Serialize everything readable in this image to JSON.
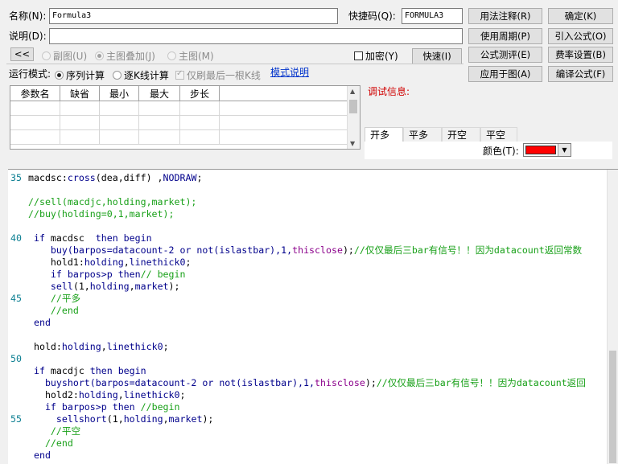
{
  "form": {
    "name_label": "名称(N):",
    "name_value": "Formula3",
    "hotkey_label": "快捷码(Q):",
    "hotkey_value": "FORMULA3",
    "desc_label": "说明(D):",
    "desc_value": "",
    "collapse_label": "<<",
    "encrypt_label": "加密(Y)",
    "run_mode_label": "运行模式:",
    "model_desc_link": "模式说明",
    "debug_label": "调试信息:"
  },
  "buttons": {
    "usage_note": "用法注释(R)",
    "ok": "确定(K)",
    "use_period": "使用周期(P)",
    "import_formula": "引入公式(O)",
    "fast_test": "快速(I)",
    "formula_eval": "公式测评(E)",
    "fee_setting": "费率设置(B)",
    "apply_chart": "应用于图(A)",
    "compile": "编译公式(F)"
  },
  "display_options": [
    {
      "label": "副图(U)",
      "checked": false
    },
    {
      "label": "主图叠加(J)",
      "checked": true
    },
    {
      "label": "主图(M)",
      "checked": false
    }
  ],
  "run_modes": [
    {
      "label": "序列计算",
      "checked": true
    },
    {
      "label": "逐K线计算",
      "checked": false
    }
  ],
  "refresh_last_bar": {
    "label": "仅刷最后一根K线",
    "checked": true
  },
  "params_table": {
    "headers": [
      "参数名",
      "缺省",
      "最小",
      "最大",
      "步长"
    ],
    "rows": [
      [
        "",
        "",
        "",
        "",
        ""
      ],
      [
        "",
        "",
        "",
        "",
        ""
      ],
      [
        "",
        "",
        "",
        "",
        ""
      ]
    ]
  },
  "signal_tabs": [
    "开多",
    "平多",
    "开空",
    "平空"
  ],
  "color_label": "颜色(T):",
  "color_value": "#ff0000",
  "code_lines": [
    {
      "n": "35",
      "parts": [
        {
          "t": "macdsc:",
          "c": "tx"
        },
        {
          "t": "cross",
          "c": "kw"
        },
        {
          "t": "(dea,diff) ,",
          "c": "tx"
        },
        {
          "t": "NODRAW",
          "c": "kw"
        },
        {
          "t": ";",
          "c": "tx"
        }
      ]
    },
    {
      "n": "",
      "parts": []
    },
    {
      "n": "",
      "parts": [
        {
          "t": "//sell(macdjc,holding,market);",
          "c": "cm"
        }
      ]
    },
    {
      "n": "",
      "parts": [
        {
          "t": "//buy(holding=0,1,market);",
          "c": "cm"
        }
      ]
    },
    {
      "n": "",
      "parts": []
    },
    {
      "n": "40",
      "parts": [
        {
          "t": " if ",
          "c": "kw"
        },
        {
          "t": "macdsc  ",
          "c": "tx"
        },
        {
          "t": "then begin",
          "c": "kw"
        }
      ]
    },
    {
      "n": "",
      "parts": [
        {
          "t": "    buy",
          "c": "kw"
        },
        {
          "t": "(barpos=datacount-2 ",
          "c": "kw"
        },
        {
          "t": "or not",
          "c": "kw"
        },
        {
          "t": "(islastbar),1,",
          "c": "kw"
        },
        {
          "t": "thisclose",
          "c": "mg"
        },
        {
          "t": ");",
          "c": "tx"
        },
        {
          "t": "//仅仅最后三bar有信号！！因为datacount返回常数",
          "c": "cm"
        }
      ]
    },
    {
      "n": "",
      "parts": [
        {
          "t": "    hold1:",
          "c": "tx"
        },
        {
          "t": "holding",
          "c": "kw"
        },
        {
          "t": ",",
          "c": "tx"
        },
        {
          "t": "linethick0",
          "c": "kw"
        },
        {
          "t": ";",
          "c": "tx"
        }
      ]
    },
    {
      "n": "",
      "parts": [
        {
          "t": "    if ",
          "c": "kw"
        },
        {
          "t": "barpos>p ",
          "c": "kw"
        },
        {
          "t": "then",
          "c": "kw"
        },
        {
          "t": "// begin",
          "c": "cm"
        }
      ]
    },
    {
      "n": "",
      "parts": [
        {
          "t": "    sell",
          "c": "kw"
        },
        {
          "t": "(1,",
          "c": "tx"
        },
        {
          "t": "holding",
          "c": "kw"
        },
        {
          "t": ",",
          "c": "tx"
        },
        {
          "t": "market",
          "c": "kw"
        },
        {
          "t": ");",
          "c": "tx"
        }
      ]
    },
    {
      "n": "45",
      "parts": [
        {
          "t": "    //平多",
          "c": "cm"
        }
      ]
    },
    {
      "n": "",
      "parts": [
        {
          "t": "    //end",
          "c": "cm"
        }
      ]
    },
    {
      "n": "",
      "parts": [
        {
          "t": " end",
          "c": "kw"
        }
      ]
    },
    {
      "n": "",
      "parts": []
    },
    {
      "n": "",
      "parts": [
        {
          "t": " hold:",
          "c": "tx"
        },
        {
          "t": "holding",
          "c": "kw"
        },
        {
          "t": ",",
          "c": "tx"
        },
        {
          "t": "linethick0",
          "c": "kw"
        },
        {
          "t": ";",
          "c": "tx"
        }
      ]
    },
    {
      "n": "50",
      "parts": []
    },
    {
      "n": "",
      "parts": [
        {
          "t": " if ",
          "c": "kw"
        },
        {
          "t": "macdjc ",
          "c": "tx"
        },
        {
          "t": "then begin",
          "c": "kw"
        }
      ]
    },
    {
      "n": "",
      "parts": [
        {
          "t": "   buyshort",
          "c": "kw"
        },
        {
          "t": "(barpos=datacount-2 ",
          "c": "kw"
        },
        {
          "t": "or not",
          "c": "kw"
        },
        {
          "t": "(islastbar),1,",
          "c": "kw"
        },
        {
          "t": "thisclose",
          "c": "mg"
        },
        {
          "t": ");",
          "c": "tx"
        },
        {
          "t": "//仅仅最后三bar有信号！！因为datacount返回",
          "c": "cm"
        }
      ]
    },
    {
      "n": "",
      "parts": [
        {
          "t": "   hold2:",
          "c": "tx"
        },
        {
          "t": "holding",
          "c": "kw"
        },
        {
          "t": ",",
          "c": "tx"
        },
        {
          "t": "linethick0",
          "c": "kw"
        },
        {
          "t": ";",
          "c": "tx"
        }
      ]
    },
    {
      "n": "",
      "parts": [
        {
          "t": "   if ",
          "c": "kw"
        },
        {
          "t": "barpos>p ",
          "c": "kw"
        },
        {
          "t": "then ",
          "c": "kw"
        },
        {
          "t": "//begin",
          "c": "cm"
        }
      ]
    },
    {
      "n": "55",
      "parts": [
        {
          "t": "     sellshort",
          "c": "kw"
        },
        {
          "t": "(1,",
          "c": "tx"
        },
        {
          "t": "holding",
          "c": "kw"
        },
        {
          "t": ",",
          "c": "tx"
        },
        {
          "t": "market",
          "c": "kw"
        },
        {
          "t": ");",
          "c": "tx"
        }
      ]
    },
    {
      "n": "",
      "parts": [
        {
          "t": "    //平空",
          "c": "cm"
        }
      ]
    },
    {
      "n": "",
      "parts": [
        {
          "t": "   //end",
          "c": "cm"
        }
      ]
    },
    {
      "n": "",
      "parts": [
        {
          "t": " end",
          "c": "kw"
        }
      ]
    }
  ]
}
